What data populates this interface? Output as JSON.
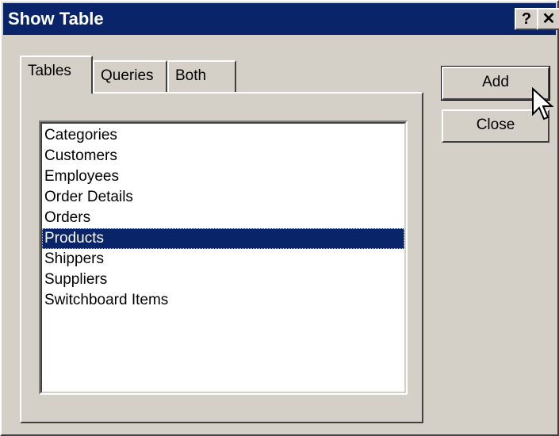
{
  "window": {
    "title": "Show Table",
    "help_button": "?",
    "close_button": "✕"
  },
  "tabs": [
    {
      "label": "Tables",
      "active": true
    },
    {
      "label": "Queries",
      "active": false
    },
    {
      "label": "Both",
      "active": false
    }
  ],
  "list": {
    "items": [
      "Categories",
      "Customers",
      "Employees",
      "Order Details",
      "Orders",
      "Products",
      "Shippers",
      "Suppliers",
      "Switchboard Items"
    ],
    "selected": "Products"
  },
  "buttons": {
    "add": "Add",
    "close": "Close"
  },
  "colors": {
    "titlebar": "#0a246a",
    "selection": "#0a246a",
    "face": "#d4d0c8"
  },
  "icons": {
    "cursor": "arrow-pointer-icon"
  }
}
